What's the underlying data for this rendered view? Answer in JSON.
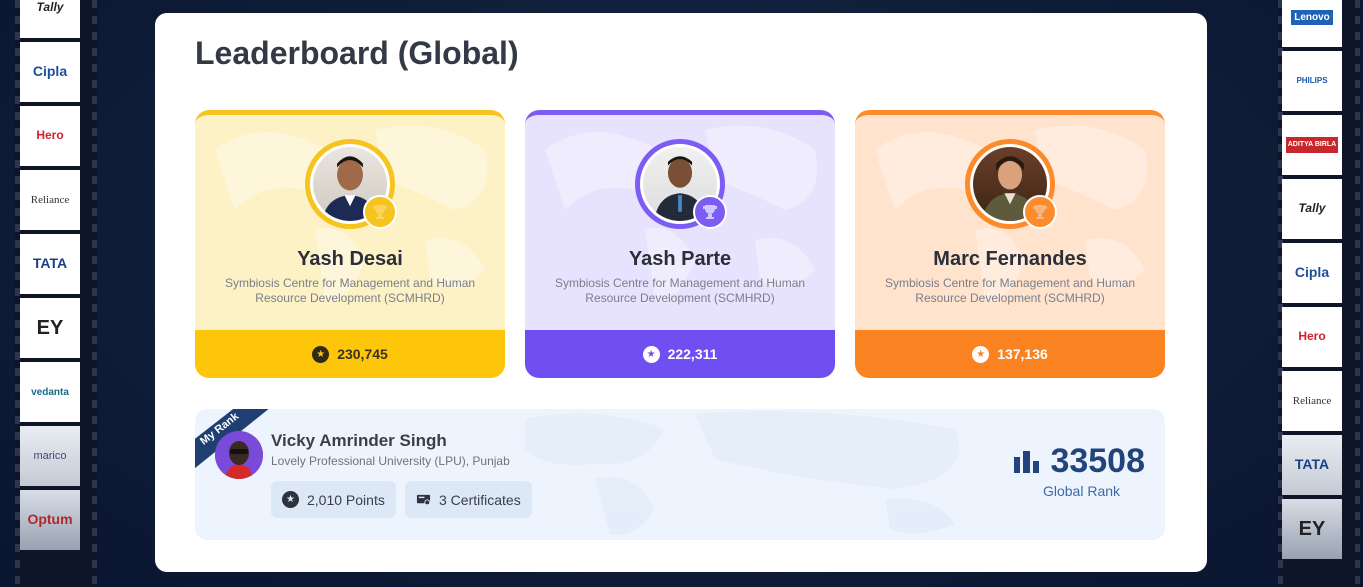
{
  "page": {
    "title": "Leaderboard (Global)"
  },
  "left_strip": [
    "Tally",
    "Cipla",
    "Hero",
    "Reliance",
    "TATA",
    "EY",
    "vedanta",
    "marico",
    "Optum"
  ],
  "right_strip": [
    "Lenovo",
    "PHILIPS",
    "ADITYA BIRLA",
    "Tally",
    "Cipla",
    "Hero",
    "Reliance",
    "TATA",
    "EY"
  ],
  "podium": [
    {
      "rank": 1,
      "name": "Yash Desai",
      "institute": "Symbiosis Centre for Management and Human Resource Development (SCMHRD)",
      "points": "230,745",
      "theme": {
        "bg": "#fdf2c6",
        "accent": "#f7c31f",
        "bottom": "#fdc60a",
        "text": "#3a3220"
      }
    },
    {
      "rank": 2,
      "name": "Yash Parte",
      "institute": "Symbiosis Centre for Management and Human Resource Development (SCMHRD)",
      "points": "222,311",
      "theme": {
        "bg": "#e7e2fd",
        "accent": "#7c5cf2",
        "bottom": "#6f4ff2",
        "text": "#ffffff"
      }
    },
    {
      "rank": 3,
      "name": "Marc Fernandes",
      "institute": "Symbiosis Centre for Management and Human Resource Development (SCMHRD)",
      "points": "137,136",
      "theme": {
        "bg": "#ffe3cd",
        "accent": "#fb8b2b",
        "bottom": "#fb8220",
        "text": "#ffffff"
      }
    }
  ],
  "my_rank": {
    "ribbon": "My Rank",
    "name": "Vicky Amrinder Singh",
    "institute": "Lovely Professional University (LPU), Punjab",
    "points_chip": "2,010 Points",
    "certificates_chip": "3 Certificates",
    "rank_value": "33508",
    "rank_label": "Global Rank"
  }
}
